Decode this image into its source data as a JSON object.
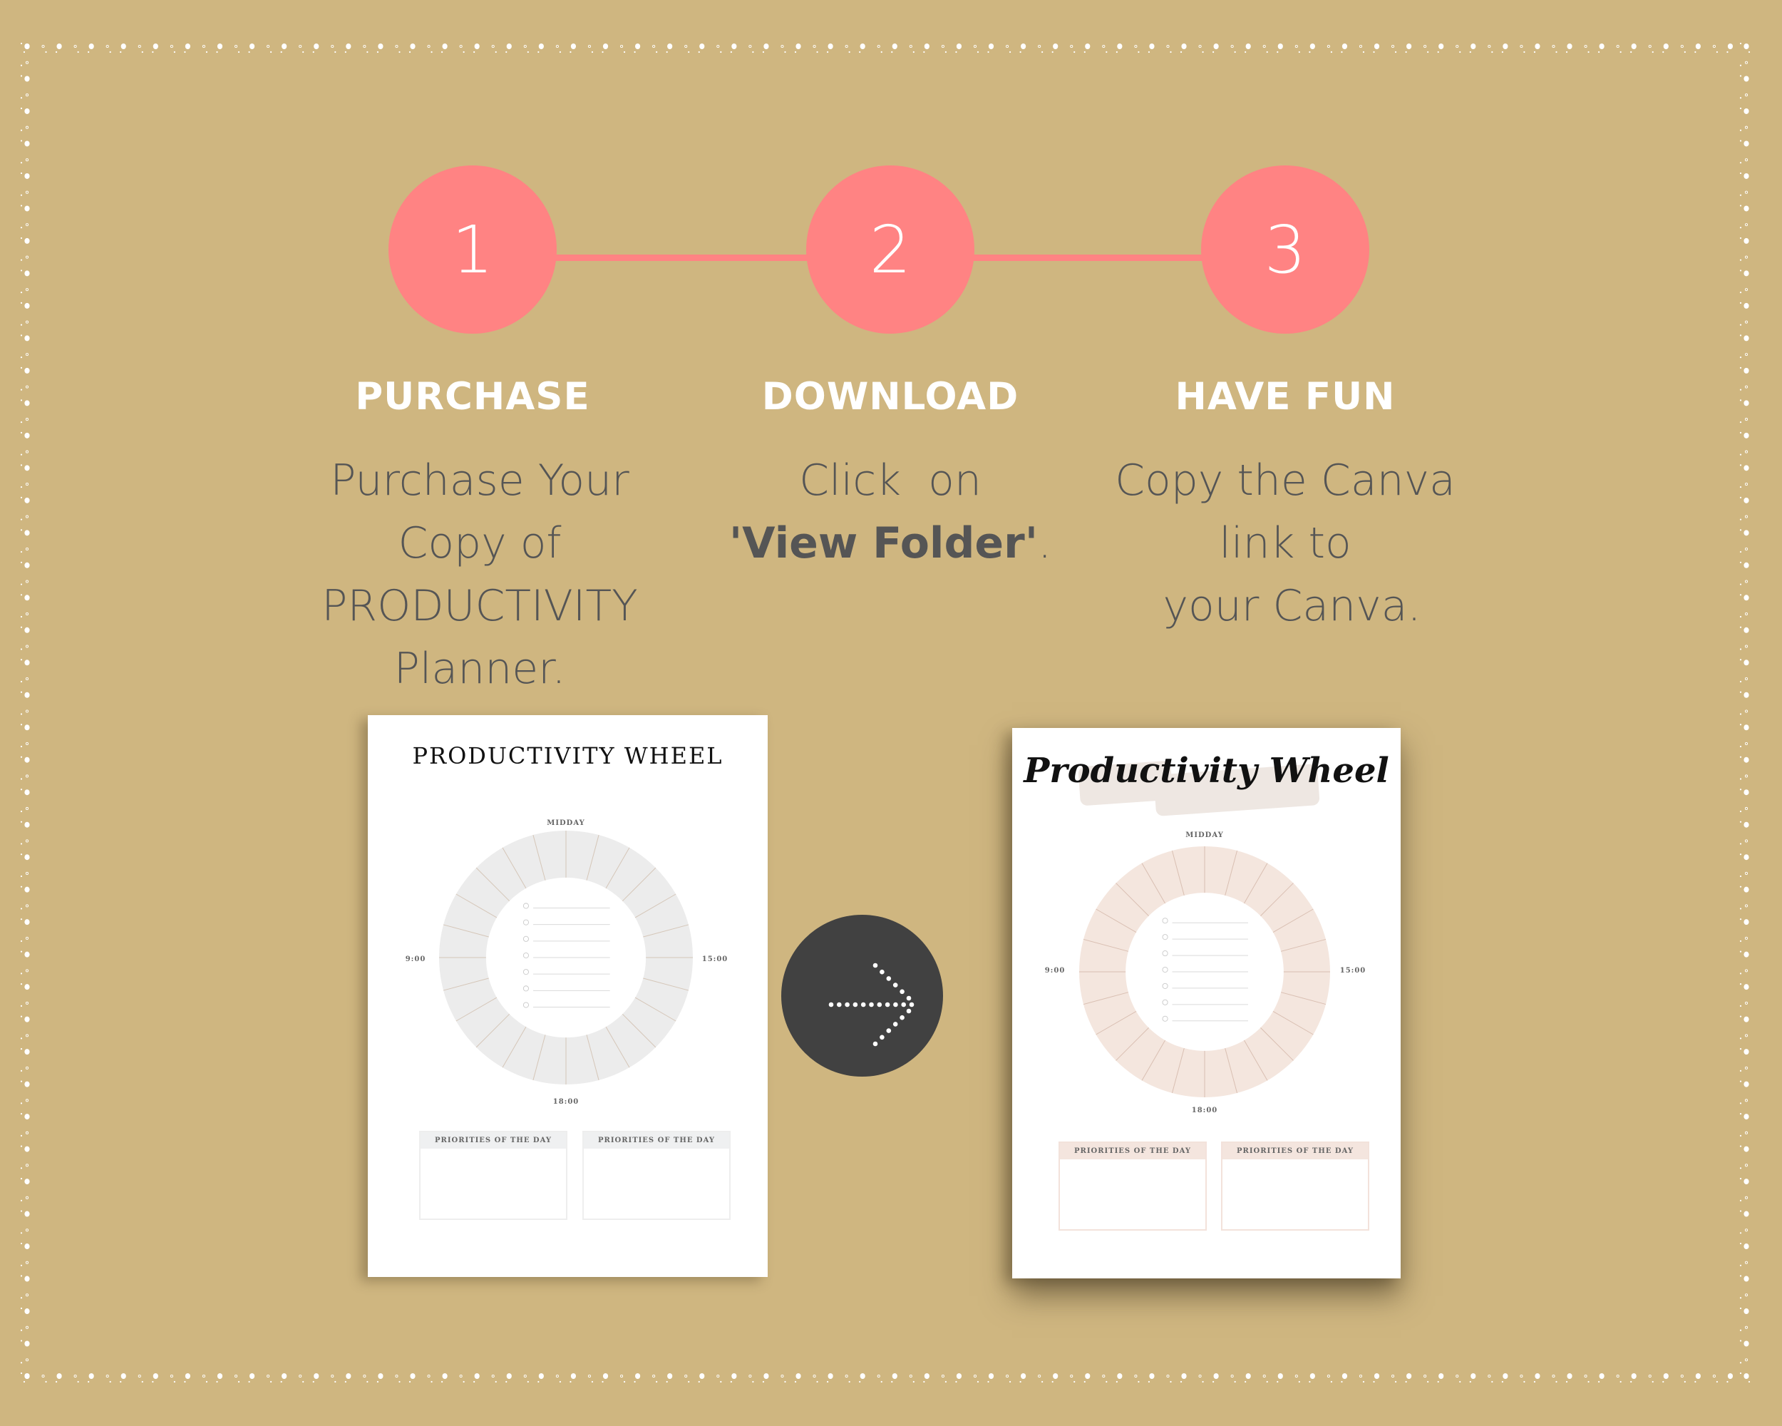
{
  "colors": {
    "background": "#CFB680",
    "accent": "#FF8383",
    "step_title": "#FFFFFF",
    "step_text": "#555555",
    "arrow_circle": "#414141"
  },
  "steps": [
    {
      "number": "1",
      "title": "PURCHASE",
      "lines": [
        {
          "text": "Purchase Your"
        },
        {
          "text": "Copy of"
        },
        {
          "text": "PRODUCTIVITY"
        },
        {
          "text": "Planner."
        }
      ]
    },
    {
      "number": "2",
      "title": "DOWNLOAD",
      "lines": [
        {
          "text": "Click  on"
        },
        {
          "bold": "'View Folder'",
          "text": "."
        }
      ]
    },
    {
      "number": "3",
      "title": "HAVE FUN",
      "lines": [
        {
          "text": "Copy the Canva"
        },
        {
          "text": "link to"
        },
        {
          "text": " your Canva."
        }
      ]
    }
  ],
  "arrow": {
    "icon": "dotted-arrow-right-icon"
  },
  "planner_before": {
    "title": "PRODUCTIVITY WHEEL",
    "wheel_labels": {
      "top": "MIDDAY",
      "left": "9:00",
      "right": "15:00",
      "bottom": "18:00"
    },
    "segments": 24,
    "checklist_items": 7,
    "ring_color": "#ECECEC",
    "divider_color": "#D5C6B8",
    "priority_boxes": [
      {
        "title": "PRIORITIES OF THE DAY"
      },
      {
        "title": "PRIORITIES OF THE DAY"
      }
    ]
  },
  "planner_after": {
    "title": "Productivity Wheel",
    "wheel_labels": {
      "top": "MIDDAY",
      "left": "9:00",
      "right": "15:00",
      "bottom": "18:00"
    },
    "segments": 24,
    "checklist_items": 7,
    "ring_color": "#F4E6DE",
    "divider_color": "#D9BFB2",
    "priority_boxes": [
      {
        "title": "PRIORITIES OF THE DAY"
      },
      {
        "title": "PRIORITIES OF THE DAY"
      }
    ]
  }
}
